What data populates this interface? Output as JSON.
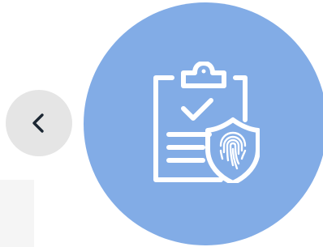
{
  "nav": {
    "back_icon": "chevron-left-icon",
    "back_button_color": "#e5e5e5",
    "back_icon_color": "#1c2733"
  },
  "hero": {
    "icon": "clipboard-check-shield-fingerprint-icon",
    "circle_color": "#82ace6",
    "icon_color": "#ffffff"
  },
  "left_panel": {
    "color": "#f5f5f5"
  }
}
